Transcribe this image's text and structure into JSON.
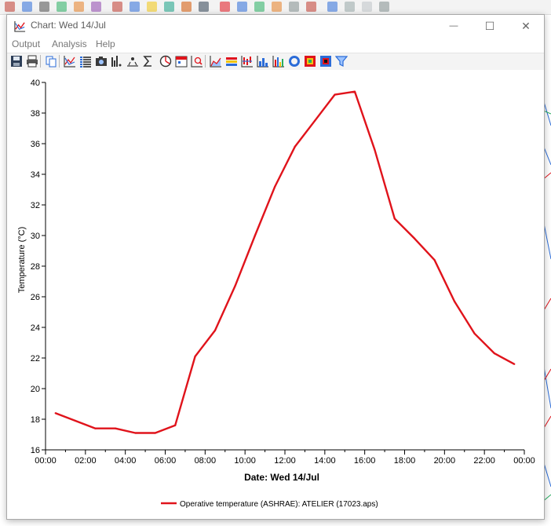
{
  "window": {
    "title": "Chart: Wed 14/Jul",
    "minimize_glyph": "—",
    "maximize_glyph": "☐",
    "close_glyph": "✕"
  },
  "menu": {
    "items": [
      "Output",
      "Analysis",
      "Help"
    ]
  },
  "toolbar": {
    "icons": [
      "save-icon",
      "print-icon",
      "copy-icon",
      "line-chart-icon",
      "list-icon",
      "camera-icon",
      "peak-icon",
      "distribution-icon",
      "sum-icon",
      "pie-icon",
      "calendar-icon",
      "zoom-chart-icon",
      "area-chart-icon",
      "band-chart-icon",
      "range-chart-icon",
      "histogram-icon",
      "bar-chart-icon",
      "donut-icon",
      "heatmap-icon",
      "contour-icon",
      "filter-icon"
    ]
  },
  "colors": {
    "series": "#e0131b",
    "accent": "#2b6cd8"
  },
  "chart_data": {
    "type": "line",
    "xlabel": "Date: Wed 14/Jul",
    "ylabel": "Temperature (°C)",
    "xlim": [
      0,
      24
    ],
    "ylim": [
      16,
      40
    ],
    "x_ticks": [
      "00:00",
      "02:00",
      "04:00",
      "06:00",
      "08:00",
      "10:00",
      "12:00",
      "14:00",
      "16:00",
      "18:00",
      "20:00",
      "22:00",
      "00:00"
    ],
    "y_ticks": [
      16,
      18,
      20,
      22,
      24,
      26,
      28,
      30,
      32,
      34,
      36,
      38,
      40
    ],
    "grid": false,
    "legend_position": "bottom",
    "series": [
      {
        "name": "Operative temperature (ASHRAE): ATELIER (17023.aps)",
        "x": [
          0.5,
          1.5,
          2.5,
          3.5,
          4.5,
          5.5,
          6.5,
          7.5,
          8.5,
          9.5,
          10.5,
          11.5,
          12.5,
          13.5,
          14.5,
          15.5,
          16.5,
          17.5,
          18.5,
          19.5,
          20.5,
          21.5,
          22.5,
          23.5
        ],
        "values": [
          18.4,
          17.9,
          17.4,
          17.4,
          17.1,
          17.1,
          17.6,
          22.1,
          23.8,
          26.7,
          30.0,
          33.2,
          35.8,
          37.5,
          39.2,
          39.4,
          35.6,
          31.1,
          29.8,
          28.4,
          25.7,
          23.6,
          22.3,
          21.6
        ]
      }
    ]
  }
}
